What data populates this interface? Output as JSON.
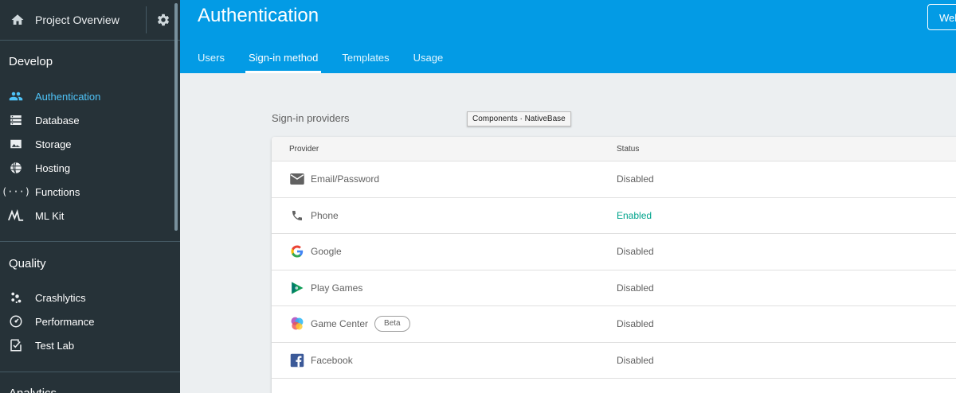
{
  "sidebar": {
    "project_title": "Project Overview",
    "sections": [
      {
        "title": "Develop",
        "items": [
          {
            "label": "Authentication",
            "icon": "people-icon",
            "active": true
          },
          {
            "label": "Database",
            "icon": "database-icon"
          },
          {
            "label": "Storage",
            "icon": "image-icon"
          },
          {
            "label": "Hosting",
            "icon": "globe-icon"
          },
          {
            "label": "Functions",
            "icon": "functions-icon"
          },
          {
            "label": "ML Kit",
            "icon": "ml-kit-icon"
          }
        ]
      },
      {
        "title": "Quality",
        "items": [
          {
            "label": "Crashlytics",
            "icon": "crashlytics-icon"
          },
          {
            "label": "Performance",
            "icon": "speedometer-icon"
          },
          {
            "label": "Test Lab",
            "icon": "checklist-icon"
          }
        ]
      },
      {
        "title": "Analytics",
        "items": []
      }
    ]
  },
  "header": {
    "title": "Authentication",
    "web_button": "Web",
    "tabs": [
      "Users",
      "Sign-in method",
      "Templates",
      "Usage"
    ],
    "active_tab": "Sign-in method"
  },
  "content": {
    "section_label": "Sign-in providers",
    "tooltip": "Components · NativeBase",
    "table": {
      "columns": [
        "Provider",
        "Status"
      ],
      "rows": [
        {
          "provider": "Email/Password",
          "icon": "email-icon",
          "status": "Disabled"
        },
        {
          "provider": "Phone",
          "icon": "phone-icon",
          "status": "Enabled"
        },
        {
          "provider": "Google",
          "icon": "google-icon",
          "status": "Disabled"
        },
        {
          "provider": "Play Games",
          "icon": "play-games-icon",
          "status": "Disabled"
        },
        {
          "provider": "Game Center",
          "icon": "game-center-icon",
          "status": "Disabled",
          "badge": "Beta"
        },
        {
          "provider": "Facebook",
          "icon": "facebook-icon",
          "status": "Disabled"
        }
      ]
    }
  },
  "colors": {
    "header_bg": "#039be5",
    "sidebar_bg": "#263238",
    "active_accent": "#4fc3f7",
    "enabled_status": "#00a38c"
  }
}
